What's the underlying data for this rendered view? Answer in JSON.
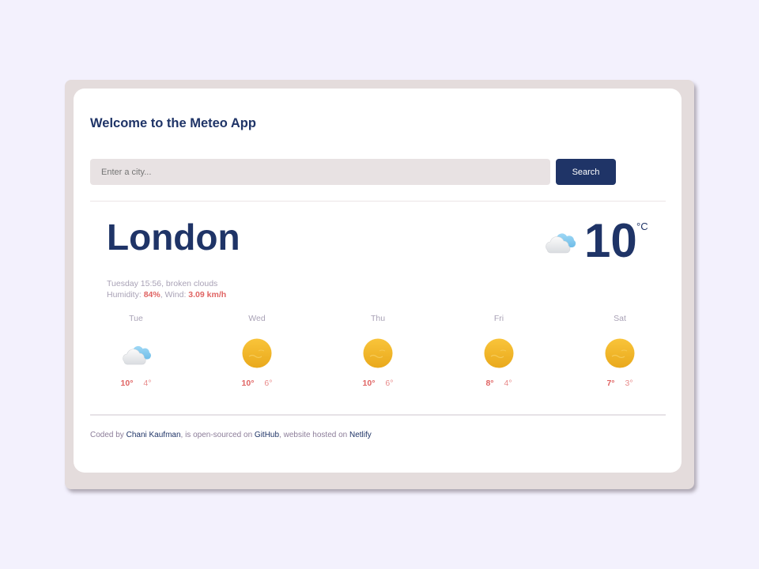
{
  "app": {
    "title": "Welcome to the Meteo App"
  },
  "search": {
    "placeholder": "Enter a city...",
    "value": "",
    "button_label": "Search"
  },
  "current": {
    "city": "London",
    "temperature": "10",
    "unit": "°C",
    "icon": "broken-clouds-icon",
    "description_line": "Tuesday 15:56, broken clouds",
    "humidity_label": "Humidity: ",
    "humidity_value": "84%",
    "wind_label": ", Wind: ",
    "wind_value": "3.09 km/h"
  },
  "forecast": [
    {
      "day": "Tue",
      "icon": "cloud-icon",
      "max": "10°",
      "min": "4°"
    },
    {
      "day": "Wed",
      "icon": "sun-icon",
      "max": "10°",
      "min": "6°"
    },
    {
      "day": "Thu",
      "icon": "sun-icon",
      "max": "10°",
      "min": "6°"
    },
    {
      "day": "Fri",
      "icon": "sun-icon",
      "max": "8°",
      "min": "4°"
    },
    {
      "day": "Sat",
      "icon": "sun-icon",
      "max": "7°",
      "min": "3°"
    }
  ],
  "footer": {
    "coded_by": "Coded by ",
    "author_link": "Chani Kaufman",
    "open_sourced": ", is open-sourced on ",
    "github_link": "GitHub",
    "hosted": ", website hosted on ",
    "netlify_link": "Netlify"
  },
  "colors": {
    "accent": "#1f3467",
    "highlight": "#e06463",
    "background": "#f3f1fd"
  }
}
